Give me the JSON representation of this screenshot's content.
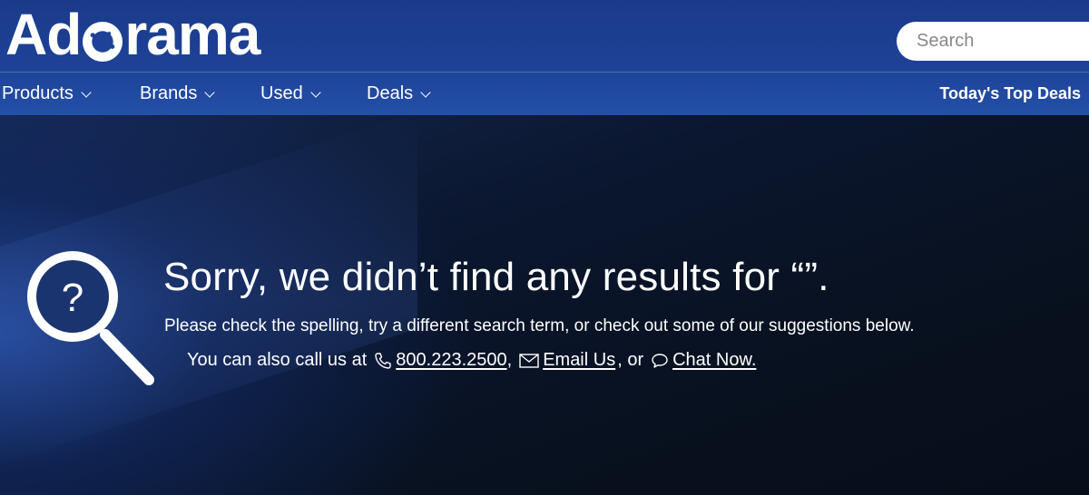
{
  "header": {
    "logo_text": "Adorama",
    "search": {
      "placeholder": "Search",
      "value": ""
    },
    "nav": [
      {
        "label": "Products"
      },
      {
        "label": "Brands"
      },
      {
        "label": "Used"
      },
      {
        "label": "Deals"
      }
    ],
    "top_deals_label": "Today's Top Deals"
  },
  "hero": {
    "title": "Sorry, we didn’t find any results for “”.",
    "subtitle": "Please check the spelling, try a different search term, or check out some of our suggestions below.",
    "contact": {
      "prefix": "You can also call us at",
      "phone": "800.223.2500",
      "sep1": ",",
      "email_label": "Email Us",
      "sep2": ", or",
      "chat_label": "Chat Now."
    },
    "icons": {
      "hero": "magnifier-question-icon",
      "phone": "phone-icon",
      "email": "envelope-icon",
      "chat": "chat-bubble-icon"
    }
  },
  "colors": {
    "header_bg": "#1e4298",
    "hero_bg": "#0a1426",
    "text": "#ffffff"
  }
}
